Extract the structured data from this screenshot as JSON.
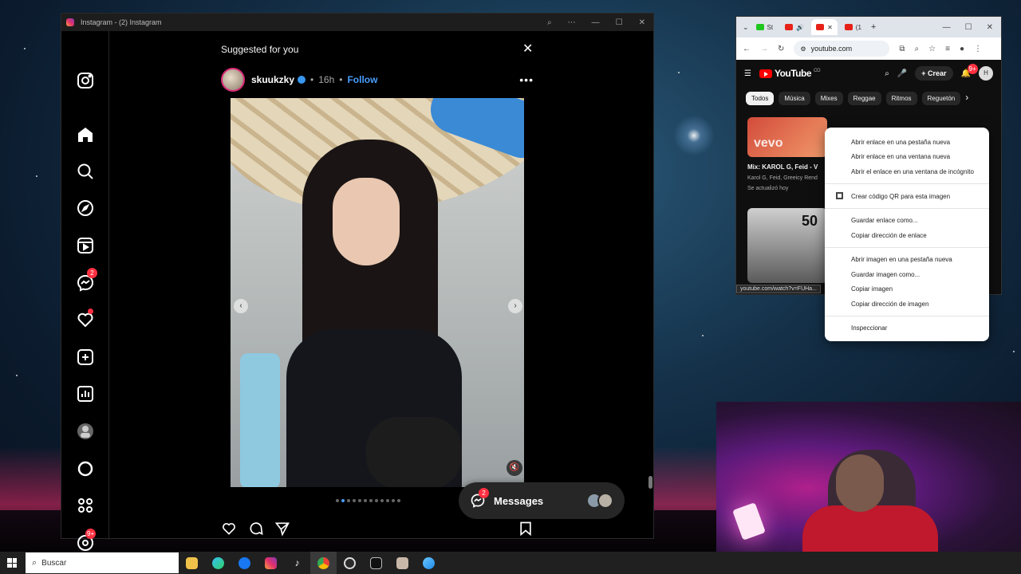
{
  "instagram": {
    "window_title": "Instagram - (2) Instagram",
    "section_title": "Suggested for you",
    "post": {
      "username": "skuukzky",
      "time": "16h",
      "separator": "•",
      "follow_label": "Follow",
      "carousel_total": 12,
      "carousel_active_index": 1
    },
    "rail_badges": {
      "messenger": "2",
      "threads": "9+"
    },
    "messages": {
      "label": "Messages",
      "badge": "2"
    }
  },
  "chrome": {
    "tabs": [
      {
        "label": "St",
        "favicon": "green-square"
      },
      {
        "label": "",
        "favicon": "youtube",
        "active": true
      },
      {
        "label": "(1",
        "favicon": "youtube"
      }
    ],
    "url": "youtube.com",
    "youtube": {
      "logo_text": "YouTube",
      "country_code": "CO",
      "create_label": "Crear",
      "notif_badge": "9+",
      "avatar_letter": "H",
      "chips": [
        "Todos",
        "Música",
        "Mixes",
        "Reggae",
        "Ritmos",
        "Reguetón"
      ],
      "video1": {
        "thumb_text": "vevo",
        "title": "Mix: KAROL G, Feid - V",
        "channel": "Karol G, Feid, Greeicy Rend",
        "updated": "Se actualizó hoy"
      },
      "video2": {
        "thumb_text": "50"
      }
    },
    "status_url": "youtube.com/watch?v=FUHa..."
  },
  "context_menu": {
    "items": [
      "Abrir enlace en una pestaña nueva",
      "Abrir enlace en una ventana nueva",
      "Abrir el enlace en una ventana de incógnito",
      "Crear código QR para esta imagen",
      "Guardar enlace como...",
      "Copiar dirección de enlace",
      "Abrir imagen en una pestaña nueva",
      "Guardar imagen como...",
      "Copiar imagen",
      "Copiar dirección de imagen",
      "Inspeccionar"
    ]
  },
  "taskbar": {
    "search_placeholder": "Buscar",
    "apps": [
      "file-explorer",
      "edge",
      "facebook",
      "instagram",
      "tiktok",
      "chrome",
      "obs",
      "capcut",
      "app-thumbnail",
      "messenger"
    ]
  },
  "colors": {
    "instagram_bg": "#000000",
    "follow_blue": "#4a9eff",
    "badge_red": "#ff3040",
    "youtube_red": "#ff0000"
  }
}
